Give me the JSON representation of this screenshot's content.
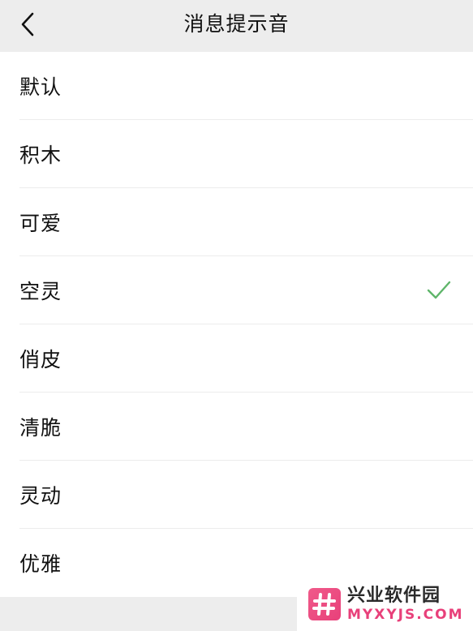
{
  "header": {
    "title": "消息提示音",
    "back_icon": "chevron-left-icon"
  },
  "sounds": [
    {
      "label": "默认",
      "selected": false
    },
    {
      "label": "积木",
      "selected": false
    },
    {
      "label": "可爱",
      "selected": false
    },
    {
      "label": "空灵",
      "selected": true
    },
    {
      "label": "俏皮",
      "selected": false
    },
    {
      "label": "清脆",
      "selected": false
    },
    {
      "label": "灵动",
      "selected": false
    },
    {
      "label": "优雅",
      "selected": false
    }
  ],
  "colors": {
    "check": "#5fb56a",
    "logo": "#e8407a"
  },
  "watermark": {
    "name": "兴业软件园",
    "domain": "MYXYJS.COM"
  }
}
